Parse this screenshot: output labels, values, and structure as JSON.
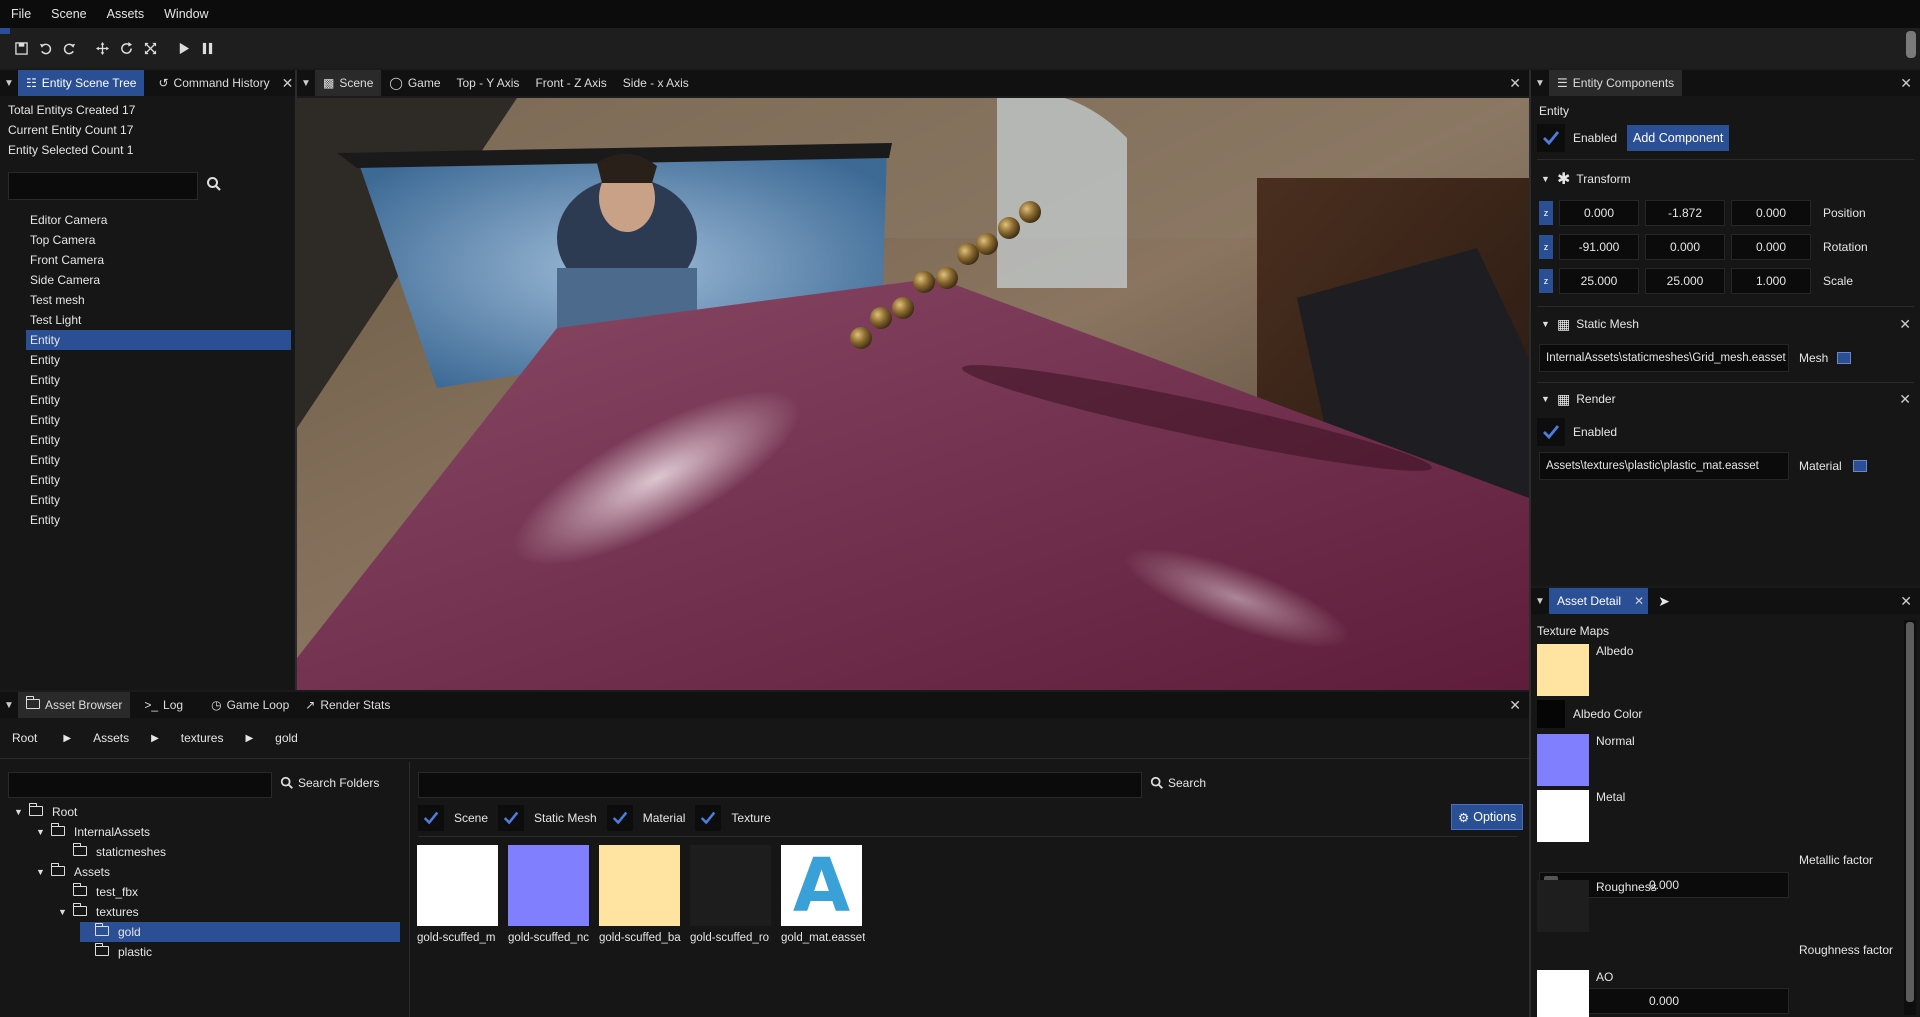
{
  "menu": [
    "File",
    "Scene",
    "Assets",
    "Window"
  ],
  "left_tabs": {
    "scene_tree": "Entity Scene Tree",
    "history": "Command History"
  },
  "stats": {
    "created": "Total Entitys Created 17",
    "current": "Current Entity Count 17",
    "selected": "Entity Selected Count 1"
  },
  "entities": [
    "Editor Camera",
    "Top Camera",
    "Front Camera",
    "Side Camera",
    "Test mesh",
    "Test Light",
    "Entity",
    "Entity",
    "Entity",
    "Entity",
    "Entity",
    "Entity",
    "Entity",
    "Entity",
    "Entity",
    "Entity"
  ],
  "selected_entity_index": 6,
  "view_tabs": [
    "Scene",
    "Game",
    "Top - Y Axis",
    "Front - Z Axis",
    "Side - x Axis"
  ],
  "components": {
    "tab": "Entity Components",
    "entity_label": "Entity",
    "enabled": "Enabled",
    "add_component": "Add Component",
    "transform": {
      "title": "Transform",
      "position": [
        "0.000",
        "-1.872",
        "0.000"
      ],
      "rotation": [
        "-91.000",
        "0.000",
        "0.000"
      ],
      "scale": [
        "25.000",
        "25.000",
        "1.000"
      ],
      "labels": [
        "Position",
        "Rotation",
        "Scale"
      ],
      "axis_btn": "z"
    },
    "static_mesh": {
      "title": "Static Mesh",
      "path": "InternalAssets\\staticmeshes\\Grid_mesh.easset",
      "label": "Mesh"
    },
    "render": {
      "title": "Render",
      "enabled": "Enabled",
      "path": "Assets\\textures\\plastic\\plastic_mat.easset",
      "label": "Material"
    }
  },
  "asset_detail": {
    "tab": "Asset Detail",
    "section": "Texture Maps",
    "albedo": "Albedo",
    "albedo_color": "Albedo Color",
    "normal": "Normal",
    "metal": "Metal",
    "metallic_factor": "0.000",
    "metallic_label": "Metallic factor",
    "roughness": "Roughness",
    "roughness_factor": "0.000",
    "roughness_label": "Roughness factor",
    "ao": "AO",
    "colors": {
      "albedo": "#ffe3a0",
      "albedo_color": "#050505",
      "normal": "#8080ff",
      "metal": "#ffffff",
      "roughness": "#1e1e1e",
      "ao": "#ffffff"
    }
  },
  "bottom_tabs": [
    "Asset Browser",
    "Log",
    "Game Loop",
    "Render Stats"
  ],
  "breadcrumb": [
    "Root",
    "Assets",
    "textures",
    "gold"
  ],
  "search_folders": "Search Folders",
  "search": "Search",
  "folder_tree": [
    {
      "label": "Root",
      "depth": 0,
      "expanded": true
    },
    {
      "label": "InternalAssets",
      "depth": 1,
      "expanded": true
    },
    {
      "label": "staticmeshes",
      "depth": 2,
      "expanded": false
    },
    {
      "label": "Assets",
      "depth": 1,
      "expanded": true
    },
    {
      "label": "test_fbx",
      "depth": 2,
      "expanded": false
    },
    {
      "label": "textures",
      "depth": 2,
      "expanded": true
    },
    {
      "label": "gold",
      "depth": 3,
      "expanded": false,
      "selected": true
    },
    {
      "label": "plastic",
      "depth": 3,
      "expanded": false
    }
  ],
  "filters": [
    "Scene",
    "Static Mesh",
    "Material",
    "Texture"
  ],
  "options": "Options",
  "assets": [
    {
      "label": "gold-scuffed_m",
      "color": "#ffffff"
    },
    {
      "label": "gold-scuffed_nc",
      "color": "#8080ff"
    },
    {
      "label": "gold-scuffed_ba",
      "color": "#ffe3a0"
    },
    {
      "label": "gold-scuffed_ro",
      "color": "#1d1d1d"
    },
    {
      "label": "gold_mat.easset",
      "color": "#ffffff",
      "letter": "A"
    }
  ]
}
